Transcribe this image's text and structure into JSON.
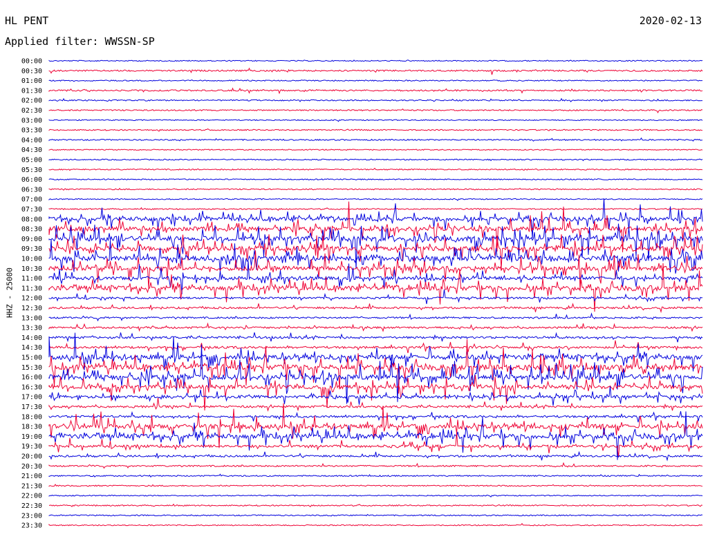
{
  "header": {
    "station": "HL PENT",
    "date": "2020-02-13",
    "filter": "Applied filter: WWSSN-SP"
  },
  "chart_data": {
    "type": "line",
    "chart_kind": "helicorder",
    "y_axis_label": "HHZ - 25000",
    "trace_colors": [
      "#0000dd",
      "#ee0033"
    ],
    "rows": [
      "00:00",
      "00:30",
      "01:00",
      "01:30",
      "02:00",
      "02:30",
      "03:00",
      "03:30",
      "04:00",
      "04:30",
      "05:00",
      "05:30",
      "06:00",
      "06:30",
      "07:00",
      "07:30",
      "08:00",
      "08:30",
      "09:00",
      "09:30",
      "10:00",
      "10:30",
      "11:00",
      "11:30",
      "12:00",
      "12:30",
      "13:00",
      "13:30",
      "14:00",
      "14:30",
      "15:00",
      "15:30",
      "16:00",
      "16:30",
      "17:00",
      "17:30",
      "18:00",
      "18:30",
      "19:00",
      "19:30",
      "20:00",
      "20:30",
      "21:00",
      "21:30",
      "22:00",
      "22:30",
      "23:00",
      "23:30"
    ],
    "row_activity": [
      0.05,
      0.15,
      0.06,
      0.15,
      0.1,
      0.1,
      0.05,
      0.08,
      0.1,
      0.03,
      0.06,
      0.08,
      0.06,
      0.08,
      0.05,
      0.08,
      0.7,
      0.8,
      0.9,
      0.9,
      0.9,
      0.8,
      0.6,
      0.85,
      0.25,
      0.25,
      0.2,
      0.25,
      0.3,
      0.3,
      0.85,
      0.95,
      0.95,
      0.7,
      0.5,
      0.3,
      0.3,
      0.8,
      0.85,
      0.4,
      0.25,
      0.15,
      0.1,
      0.08,
      0.05,
      0.08,
      0.08,
      0.05
    ]
  }
}
